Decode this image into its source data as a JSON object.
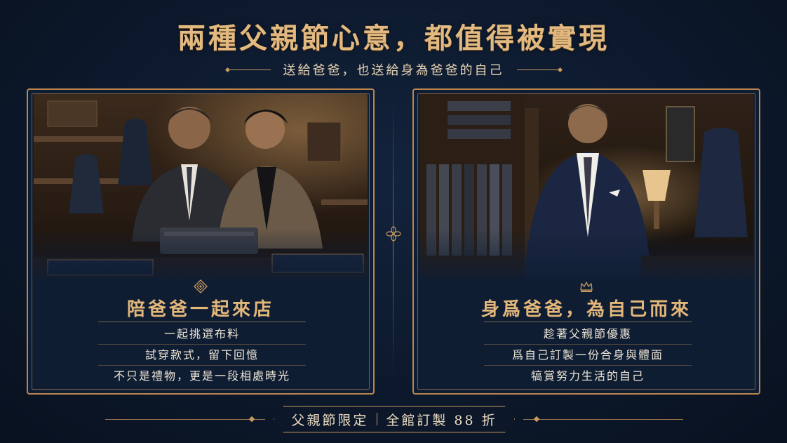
{
  "header": {
    "title": "兩種父親節心意，都值得被實現",
    "subtitle": "送給爸爸，也送給身為爸爸的自己"
  },
  "left_panel": {
    "photo_alt": "",
    "icon": "crest-icon",
    "heading": "陪爸爸一起來店",
    "items": [
      {
        "text": "一起挑選布料"
      },
      {
        "text": "試穿款式，留下回憶"
      },
      {
        "text": "不只是禮物，更是一段相處時光"
      }
    ]
  },
  "right_panel": {
    "icon": "crown-icon",
    "heading": "身爲爸爸，為自己而來",
    "items": [
      {
        "text": "趁著父親節優惠"
      },
      {
        "text": "爲自己訂製一份合身與體面"
      },
      {
        "text": "犒賞努力生活的自己"
      }
    ]
  },
  "footer": {
    "promo_label": "父親節限定",
    "promo_offer": "全館訂製 88 折"
  },
  "colors": {
    "background": "#0d1a2e",
    "gold": "#c89a5e",
    "heading_gold": "#e3b77a",
    "text": "#eee5d6"
  }
}
